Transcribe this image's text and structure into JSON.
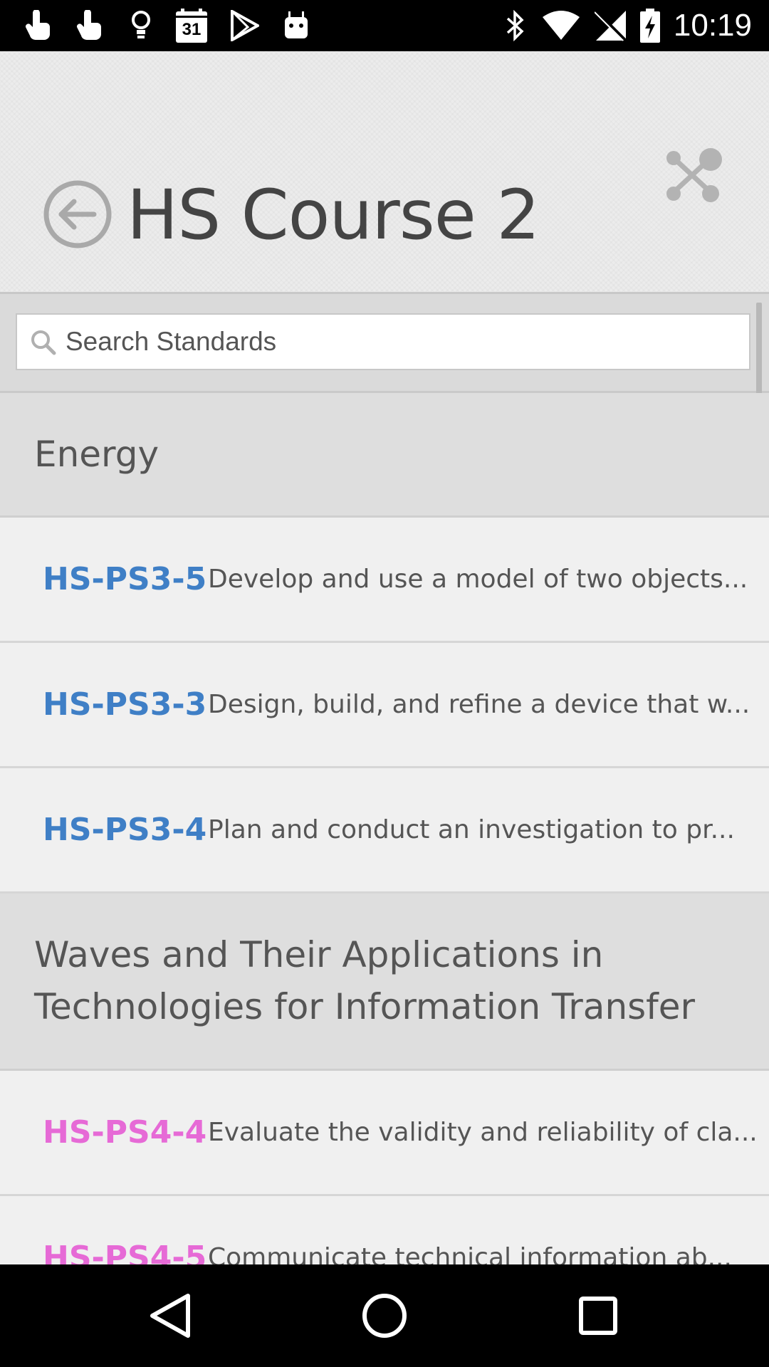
{
  "status_bar": {
    "time": "10:19",
    "calendar_day": "31",
    "icons": [
      "touch-icon",
      "touch-icon",
      "lightbulb-icon",
      "calendar-icon",
      "play-store-icon",
      "android-icon",
      "bluetooth-icon",
      "wifi-icon",
      "no-signal-icon",
      "battery-charging-icon"
    ]
  },
  "header": {
    "title": "HS Course 2",
    "back_icon": "back-arrow-icon",
    "share_icon": "share-icon"
  },
  "search": {
    "placeholder": "Search Standards"
  },
  "sections": [
    {
      "title": "Energy",
      "color": "#3f7fc6",
      "items": [
        {
          "code": "HS-PS3-5",
          "description": "Develop and use a model of two objects..."
        },
        {
          "code": "HS-PS3-3",
          "description": "Design, build, and refine a device that w..."
        },
        {
          "code": "HS-PS3-4",
          "description": "Plan and conduct an investigation to pr..."
        }
      ]
    },
    {
      "title_line1": "Waves and Their Applications in",
      "title_line2": "Technologies for Information Transfer",
      "color": "#e66ad6",
      "items": [
        {
          "code": "HS-PS4-4",
          "description": "Evaluate the validity and reliability of cla..."
        },
        {
          "code": "HS-PS4-5",
          "description": "Communicate technical information ab..."
        }
      ]
    }
  ],
  "nav_bar": {
    "back": "back-triangle-icon",
    "home": "home-circle-icon",
    "recents": "recents-square-icon"
  }
}
